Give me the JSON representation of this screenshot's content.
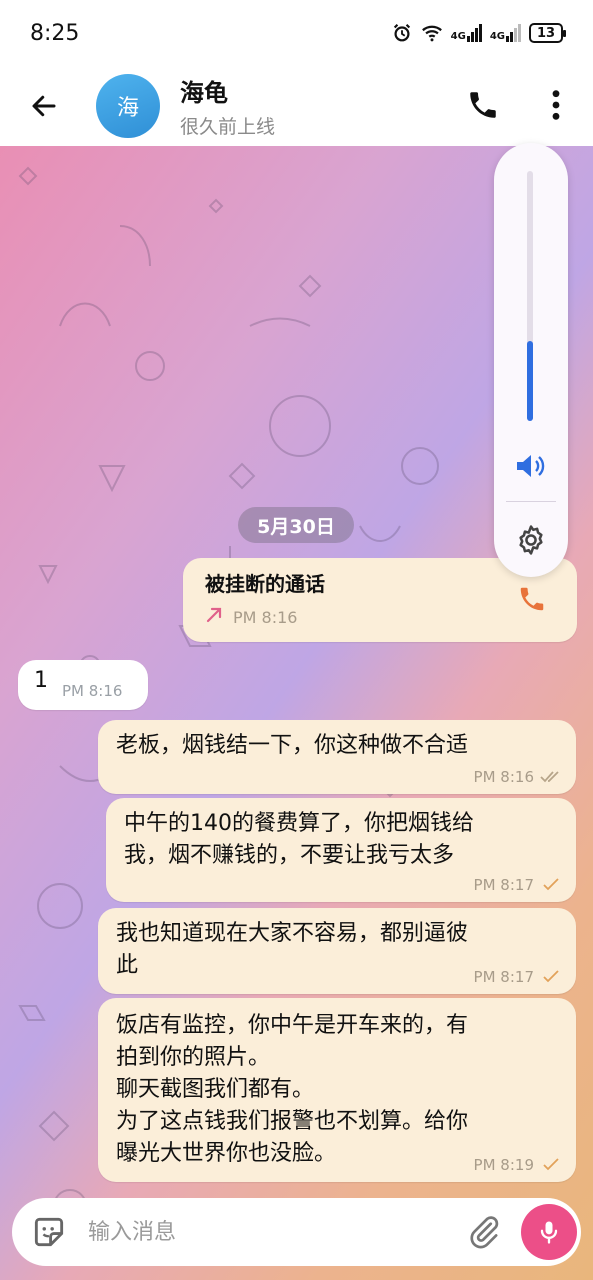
{
  "status_bar": {
    "time": "8:25",
    "network_1": "4G",
    "network_2": "4G",
    "battery": "13",
    "icons": [
      "alarm-icon",
      "wifi-icon",
      "signal-icon",
      "signal-icon",
      "battery-icon"
    ]
  },
  "header": {
    "avatar_letter": "海",
    "title": "海龟",
    "subtitle": "很久前上线",
    "icons": [
      "back-arrow-icon",
      "phone-icon",
      "more-vertical-icon"
    ]
  },
  "volume_panel": {
    "level": 0.32,
    "icons": [
      "speaker-icon",
      "gear-icon"
    ],
    "accent": "#2f6ee0"
  },
  "chat": {
    "date": "5月30日",
    "call": {
      "title": "被挂断的通话",
      "time": "PM 8:16",
      "icons": [
        "outgoing-arrow-icon",
        "phone-icon"
      ]
    },
    "incoming": {
      "text": "1",
      "time": "PM 8:16"
    },
    "outgoing": [
      {
        "text": "老板，烟钱结一下，你这种做不合适",
        "time": "PM 8:16",
        "status": "read"
      },
      {
        "text": "中午的140的餐费算了，你把烟钱给\n我，烟不赚钱的，不要让我亏太多",
        "time": "PM 8:17",
        "status": "sent"
      },
      {
        "text": "我也知道现在大家不容易，都别逼彼\n此",
        "time": "PM 8:17",
        "status": "sent"
      },
      {
        "text": "饭店有监控，你中午是开车来的，有\n拍到你的照片。\n聊天截图我们都有。\n为了这点钱我们报警也不划算。给你\n曝光大世界你也没脸。",
        "time": "PM 8:19",
        "status": "sent"
      }
    ]
  },
  "input": {
    "placeholder": "输入消息",
    "icons": [
      "sticker-icon",
      "attach-icon",
      "mic-icon"
    ],
    "mic_color": "#ec4f88"
  }
}
